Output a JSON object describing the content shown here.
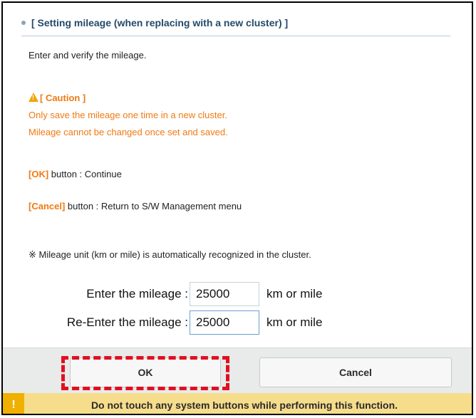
{
  "header": {
    "title": "[ Setting mileage (when replacing with a new cluster) ]"
  },
  "content": {
    "instruction": "Enter and verify the mileage.",
    "caution_title": "[ Caution ]",
    "caution_line1": "Only save the mileage one time in a new cluster.",
    "caution_line2": "Mileage cannot be changed once set and saved.",
    "ok_tag": "[OK]",
    "ok_desc": " button : Continue",
    "cancel_tag": "[Cancel]",
    "cancel_desc": " button : Return to S/W Management menu",
    "unit_note": "※ Mileage unit (km or mile) is automatically recognized in the cluster."
  },
  "form": {
    "enter_label": "Enter the mileage :",
    "enter_value": "25000",
    "reenter_label": "Re-Enter the mileage :",
    "reenter_value": "25000",
    "unit": "km or mile"
  },
  "buttons": {
    "ok_label": "OK",
    "cancel_label": "Cancel"
  },
  "notice": {
    "icon": "!",
    "text": "Do not touch any system buttons while performing this function."
  },
  "colors": {
    "caution": "#f07a12",
    "highlight": "#e01020",
    "notice_bg": "#f6dd8c",
    "notice_icon_bg": "#f0b000"
  }
}
